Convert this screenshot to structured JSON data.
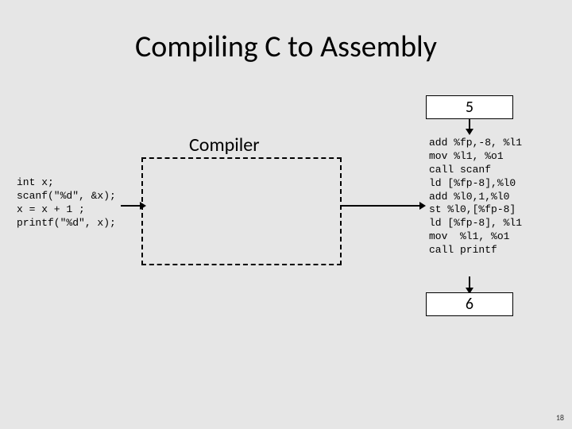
{
  "title": "Compiling C to Assembly",
  "input_value": "5",
  "output_value": "6",
  "compiler_label": "Compiler",
  "c_code": "int x;\nscanf(\"%d\", &x);\nx = x + 1 ;\nprintf(\"%d\", x);",
  "asm_code": "add %fp,-8, %l1\nmov %l1, %o1\ncall scanf\nld [%fp-8],%l0\nadd %l0,1,%l0\nst %l0,[%fp-8]\nld [%fp-8], %l1\nmov  %l1, %o1\ncall printf",
  "page_number": "18"
}
